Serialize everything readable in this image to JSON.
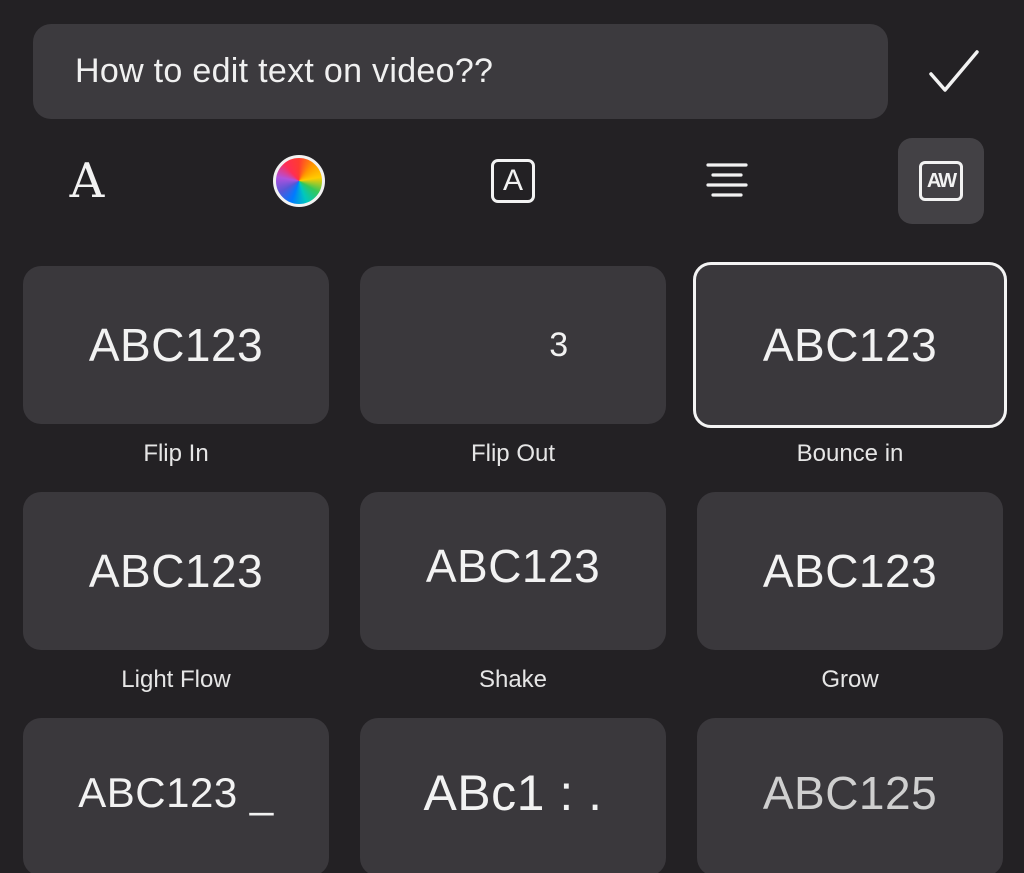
{
  "text_input": {
    "value": "How to edit text on video??"
  },
  "confirm_glyph": "✓",
  "toolbar": {
    "font_glyph": "A",
    "boxed_glyph": "A",
    "anim_glyph": "AW",
    "icons": [
      "font-icon",
      "color-wheel-icon",
      "text-box-icon",
      "align-center-icon",
      "animation-icon"
    ]
  },
  "animations": [
    {
      "preview": "ABC123",
      "label": "Flip In",
      "selected": false
    },
    {
      "preview": "3",
      "label": "Flip Out",
      "selected": false
    },
    {
      "preview": "ABC123",
      "label": "Bounce in",
      "selected": true
    },
    {
      "preview": "ABC123",
      "label": "Light Flow",
      "selected": false
    },
    {
      "preview": "ABC123",
      "label": "Shake",
      "selected": false
    },
    {
      "preview": "ABC123",
      "label": "Grow",
      "selected": false
    },
    {
      "preview": "ABC123 _",
      "label": "",
      "selected": false
    },
    {
      "preview": "ABc1 : .",
      "label": "",
      "selected": false
    },
    {
      "preview": "ABC125",
      "label": "",
      "selected": false
    }
  ],
  "colors": {
    "background": "#232124",
    "tile": "#3a383c",
    "input": "#3c3a3e",
    "selected_border": "#f4f4f4"
  }
}
